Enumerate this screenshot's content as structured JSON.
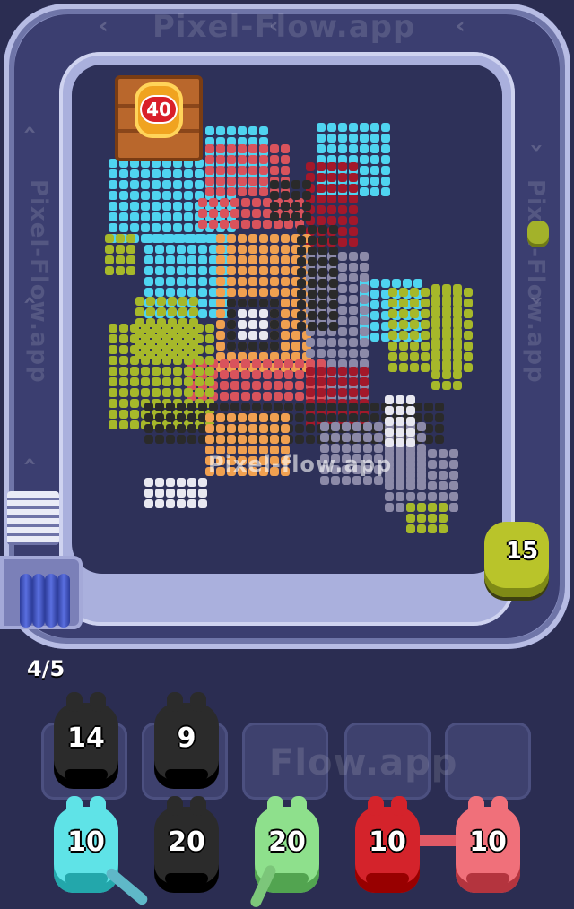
{
  "watermark_text": "Pixel-Flow.app",
  "center_watermark": "Pixel-flow.app",
  "slot_watermark": "Flow.app",
  "side_watermark_left": "Pixel-Flow.app",
  "side_watermark_right": "Pixel-Flow.app",
  "target_badge": {
    "value": "40"
  },
  "active_shooter": {
    "value": "15",
    "color": "#b9c42a"
  },
  "progress": "4/5",
  "queue_top": [
    {
      "value": "14",
      "color": "#2b2b2b"
    },
    {
      "value": "9",
      "color": "#2b2b2b"
    },
    {
      "value": "",
      "color": ""
    },
    {
      "value": "",
      "color": ""
    },
    {
      "value": "",
      "color": ""
    }
  ],
  "queue_bottom": [
    {
      "value": "10",
      "color": "#5fe3e7"
    },
    {
      "value": "20",
      "color": "#2b2b2b"
    },
    {
      "value": "20",
      "color": "#8ee08c"
    },
    {
      "value": "10",
      "color": "#d4232b"
    },
    {
      "value": "10",
      "color": "#f0707a"
    }
  ],
  "colors": {
    "background": "#2b2d52",
    "track": "#8d93c4",
    "cyan": "#4fd4f0",
    "red": "#d9535c",
    "dark_red": "#a3182a",
    "orange": "#f0a050",
    "olive": "#a6b82a",
    "black": "#2a2a2a",
    "gray": "#8c8aa8",
    "white": "#e8e8f0"
  }
}
